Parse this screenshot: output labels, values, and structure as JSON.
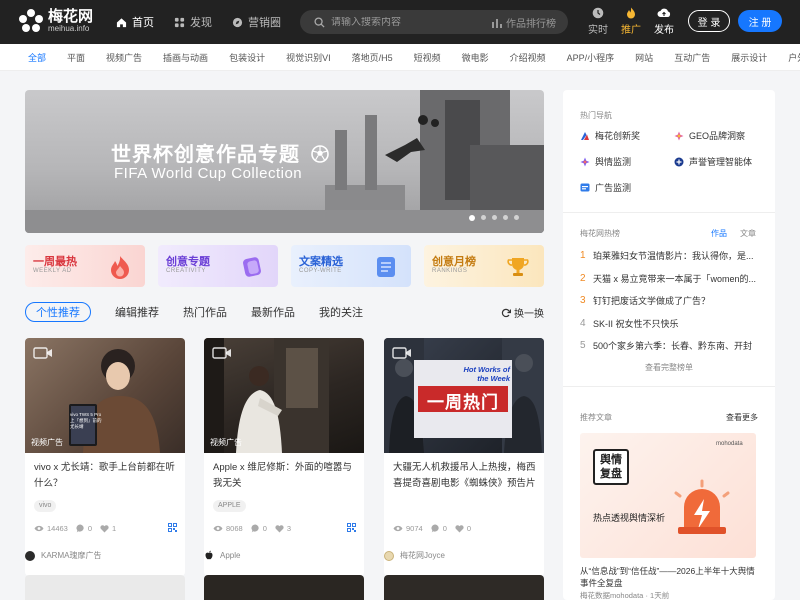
{
  "header": {
    "logo_cn": "梅花网",
    "logo_en": "meihua.info",
    "nav": [
      {
        "label": "首页",
        "icon": "home-icon"
      },
      {
        "label": "发现",
        "icon": "grid-icon"
      },
      {
        "label": "营销圈",
        "icon": "compass-icon"
      }
    ],
    "search_placeholder": "请输入搜索内容",
    "rank_label": "作品排行榜",
    "tools": [
      {
        "label": "实时",
        "icon": "clock-icon"
      },
      {
        "label": "推广",
        "icon": "flame-icon"
      },
      {
        "label": "发布",
        "icon": "cloud-upload-icon"
      }
    ],
    "login_label": "登 录",
    "register_label": "注 册"
  },
  "categories": [
    "全部",
    "平面",
    "视频广告",
    "插画与动画",
    "包装设计",
    "视觉识别VI",
    "落地页/H5",
    "短视频",
    "微电影",
    "介绍视频",
    "APP/小程序",
    "网站",
    "互动广告",
    "展示设计",
    "户外广告"
  ],
  "banner": {
    "title_cn": "世界杯创意作品专题",
    "title_en": "FIFA World Cup Collection",
    "slide_count": 5,
    "active_slide": 0
  },
  "tiles": [
    {
      "title": "一周最热",
      "subtitle": "WEEKLY AD",
      "color": "#d9363e",
      "bg": "#fde4e2"
    },
    {
      "title": "创意专题",
      "subtitle": "CREATIVITY",
      "color": "#6b3fd6",
      "bg": "#ece4fb"
    },
    {
      "title": "文案精选",
      "subtitle": "COPY-WRITE",
      "color": "#2a62d6",
      "bg": "#e2ebfb"
    },
    {
      "title": "创意月榜",
      "subtitle": "RANKINGS",
      "color": "#c47c12",
      "bg": "#fdf0d8"
    }
  ],
  "tabs": [
    "个性推荐",
    "编辑推荐",
    "热门作品",
    "最新作品",
    "我的关注"
  ],
  "refresh_label": "换一换",
  "cards": [
    {
      "badge": "视频广告",
      "title": "vivo x 尤长靖：歌手上台前都在听什么？",
      "tag": "vivo",
      "views": "14463",
      "comments": "0",
      "likes": "1",
      "author": "KARMA瑰摩广告"
    },
    {
      "badge": "视频广告",
      "title": "Apple x 维尼修斯：外面的喧嚣与我无关",
      "tag": "APPLE",
      "views": "8068",
      "comments": "0",
      "likes": "3",
      "author": "Apple"
    },
    {
      "badge": "",
      "title": "大疆无人机救援吊人上热搜，梅西喜提奇喜剧电影《蜘蛛侠》预告片｜一周",
      "tag": "",
      "views": "9074",
      "comments": "0",
      "likes": "0",
      "author": "梅花网Joyce"
    }
  ],
  "card_overlays": {
    "hot_works": "Hot Works of the Week",
    "hot_cn": "一周热门",
    "phone_caption": "vivo TWS 5 Pro",
    "phone_line2": "上『想到』前的",
    "phone_line3": "尤长靖"
  },
  "sidebar": {
    "hot_nav_title": "热门导航",
    "hot_nav": [
      {
        "label": "梅花创新奖",
        "icon": "award-icon"
      },
      {
        "label": "GEO品牌洞察",
        "icon": "geo-icon"
      },
      {
        "label": "舆情监测",
        "icon": "monitor-icon"
      },
      {
        "label": "声誉管理智能体",
        "icon": "agent-icon"
      },
      {
        "label": "广告监测",
        "icon": "ad-icon"
      }
    ],
    "rank_title": "梅花网热榜",
    "rank_tabs": [
      "作品",
      "文章"
    ],
    "rank_items": [
      "珀莱雅妇女节温情影片：我认得你，是...",
      "天猫 x 易立竞带来一本属于「women的...",
      "钉钉把废话文学做成了广告？",
      "SK-II 祝女性不只快乐",
      "500个家乡第六季：长春、黔东南、开封"
    ],
    "rank_more": "查看完整榜单",
    "articles_title": "推荐文章",
    "articles_more": "查看更多",
    "article_badge_1": "舆情",
    "article_badge_2": "复盘",
    "article_logo": "mohodata",
    "article_subtitle": "热点透视舆情深析",
    "article_title": "从“信息战”到“信任战”——2026上半年十大舆情事件全复盘",
    "article_meta": "梅花数据mohodata · 1天前"
  }
}
